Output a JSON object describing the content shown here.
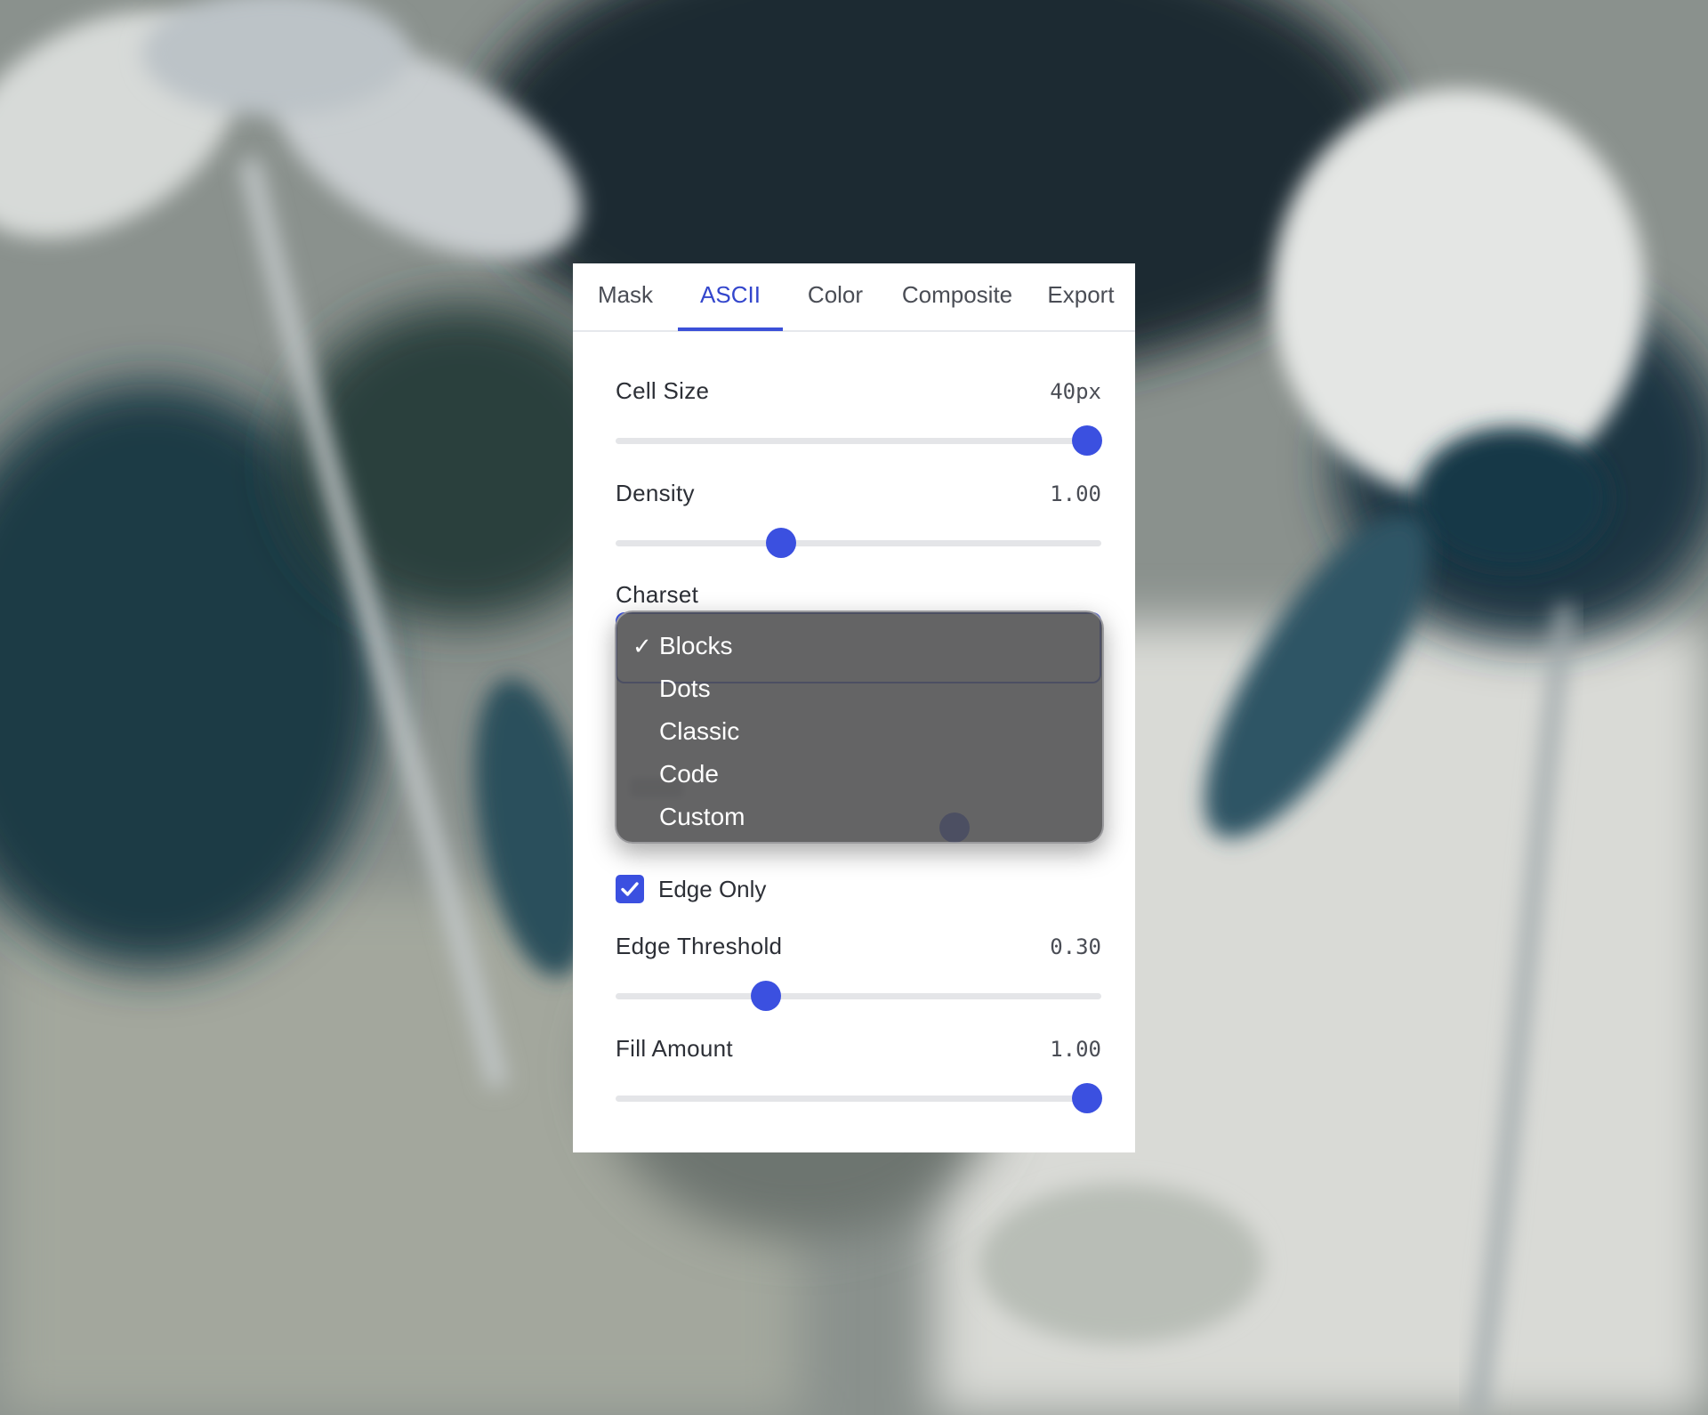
{
  "tabs": [
    {
      "label": "Mask",
      "active": false
    },
    {
      "label": "ASCII",
      "active": true
    },
    {
      "label": "Color",
      "active": false
    },
    {
      "label": "Composite",
      "active": false
    },
    {
      "label": "Export",
      "active": false
    }
  ],
  "controls": {
    "cell_size": {
      "label": "Cell Size",
      "value": "40px",
      "fraction": 0.97
    },
    "density": {
      "label": "Density",
      "value": "1.00",
      "fraction": 0.34
    },
    "charset": {
      "label": "Charset",
      "selected": "Blocks"
    },
    "edge_only": {
      "label": "Edge Only",
      "checked": true
    },
    "edge_threshold": {
      "label": "Edge Threshold",
      "value": "0.30",
      "fraction": 0.31
    },
    "fill_amount": {
      "label": "Fill Amount",
      "value": "1.00",
      "fraction": 0.97
    }
  },
  "charset_dropdown": {
    "options": [
      "Blocks",
      "Dots",
      "Classic",
      "Code",
      "Custom"
    ],
    "selected_index": 0,
    "check_glyph": "✓"
  },
  "colors": {
    "accent": "#3b50e0",
    "panel_bg": "#ffffff",
    "dropdown_bg": "#4e4e50"
  },
  "icons": {
    "checkbox": "checkmark-icon",
    "selected_option": "checkmark-icon"
  }
}
